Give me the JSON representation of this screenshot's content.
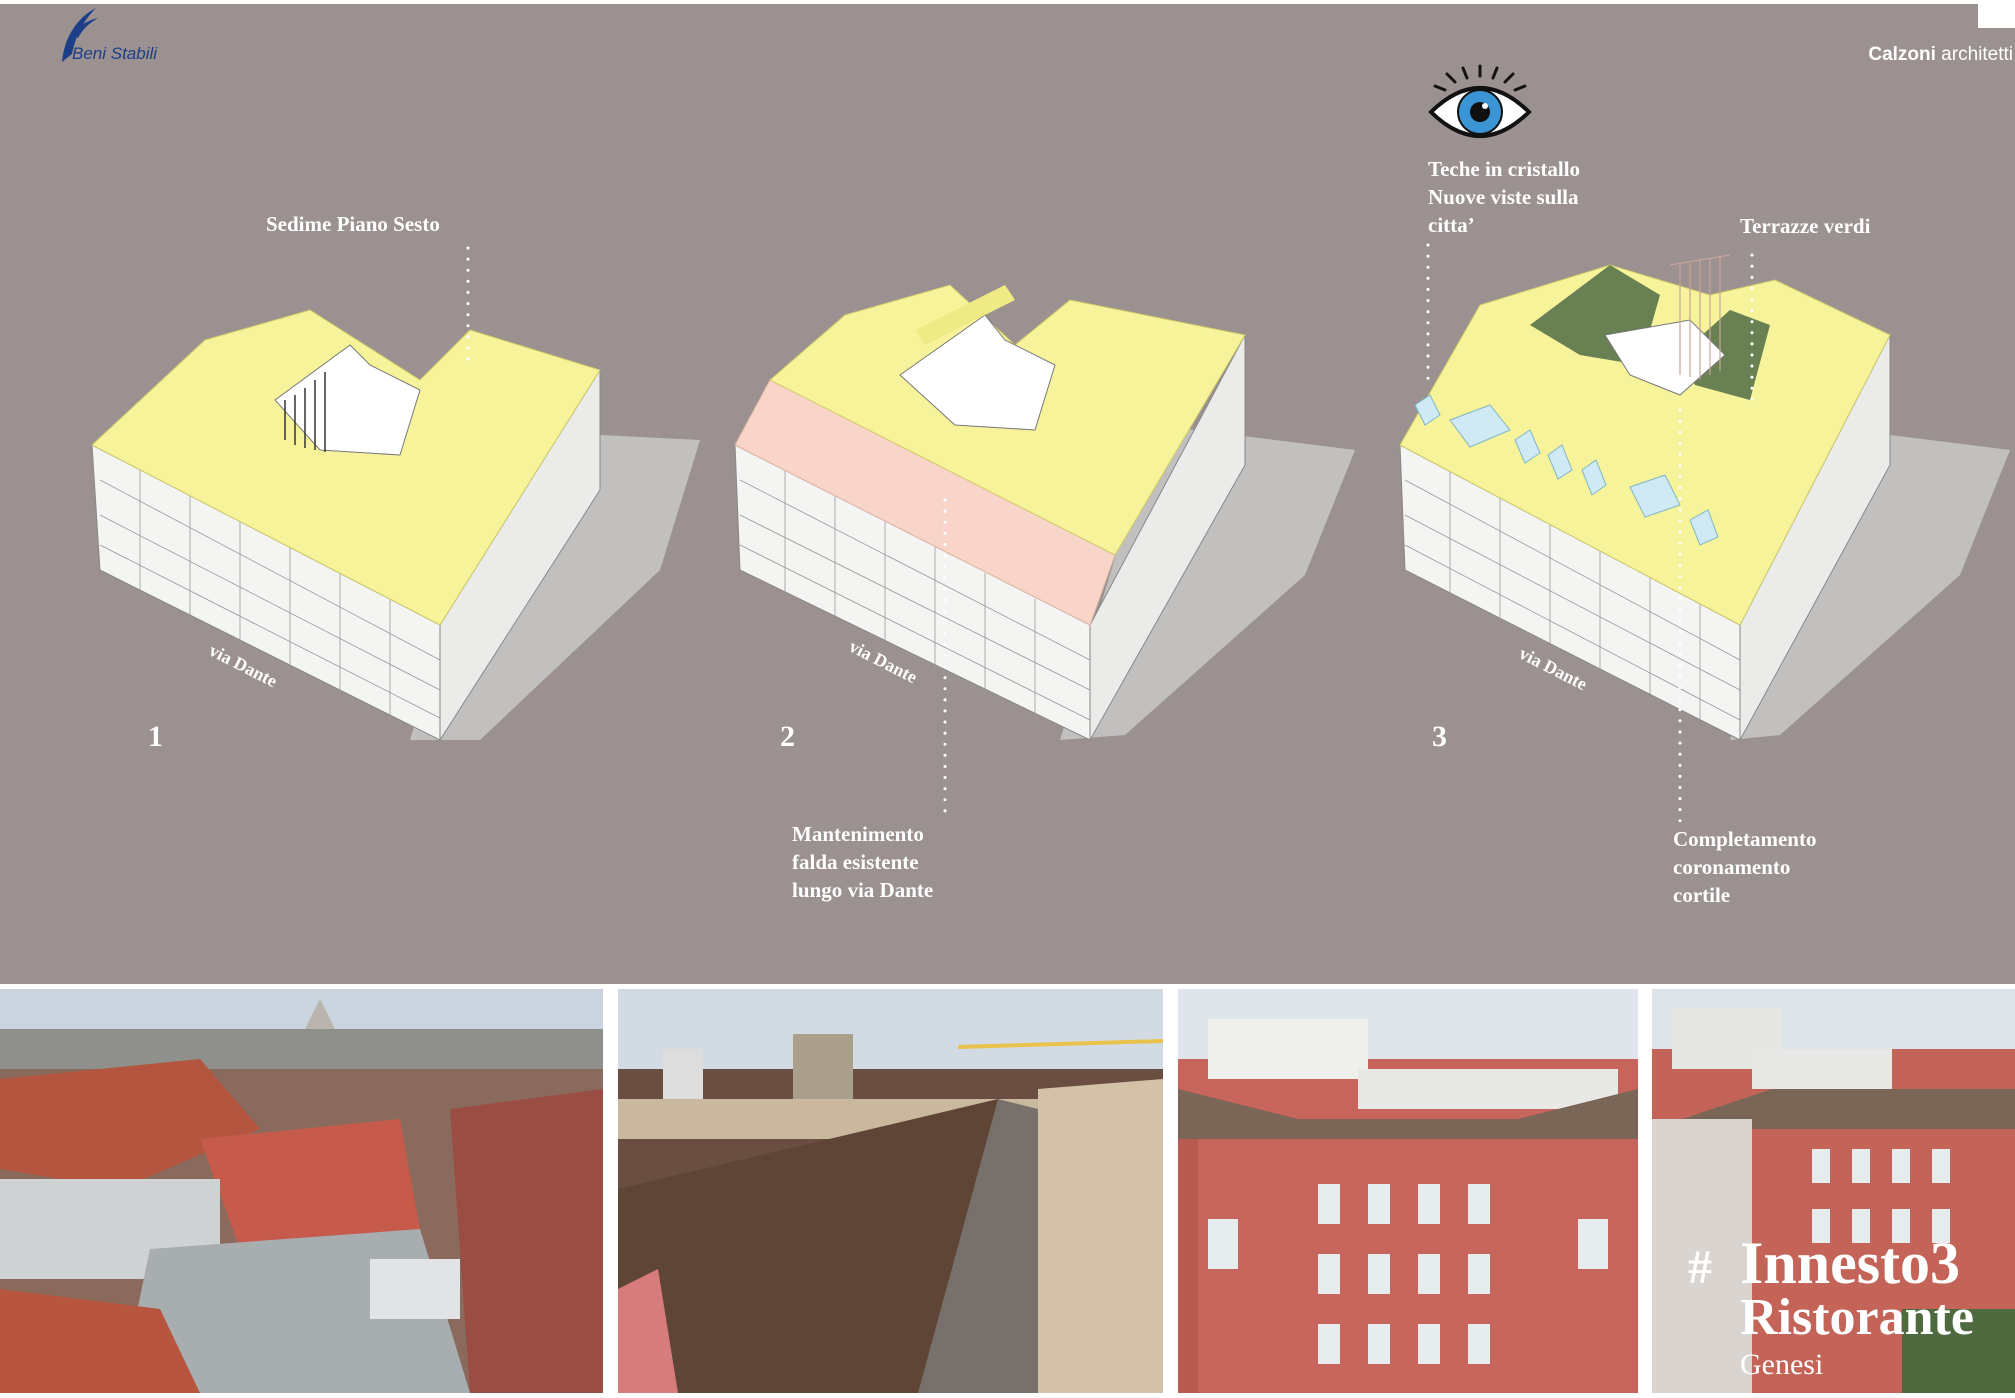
{
  "header": {
    "logo_text": "Beni Stabili",
    "studio_bold": "Calzoni",
    "studio_rest": " architetti"
  },
  "diagrams": [
    {
      "number": "1",
      "street": "via Dante",
      "label": "Sedime Piano Sesto"
    },
    {
      "number": "2",
      "street": "via Dante",
      "label_lines": [
        "Mantenimento",
        "falda esistente",
        "lungo via Dante"
      ]
    },
    {
      "number": "3",
      "street": "via Dante",
      "label_top_lines": [
        "Teche  in cristallo",
        "Nuove viste sulla",
        "citta’"
      ],
      "label_right": "Terrazze verdi",
      "label_bottom_lines": [
        "Completamento",
        "coronamento",
        "cortile"
      ]
    }
  ],
  "title": {
    "hash": "#",
    "main": "Innesto3",
    "sub": "Ristorante",
    "tag": "Genesi"
  },
  "colors": {
    "background": "#9b9190",
    "roof_yellow": "#f6f39a",
    "falda_pink": "#f8d5c8",
    "glass_blue": "#cfeaf5",
    "terrace_green": "#4f6b45",
    "logo_blue": "#1c3f88"
  },
  "icons": [
    "eye-icon",
    "beni-stabili-logo"
  ]
}
